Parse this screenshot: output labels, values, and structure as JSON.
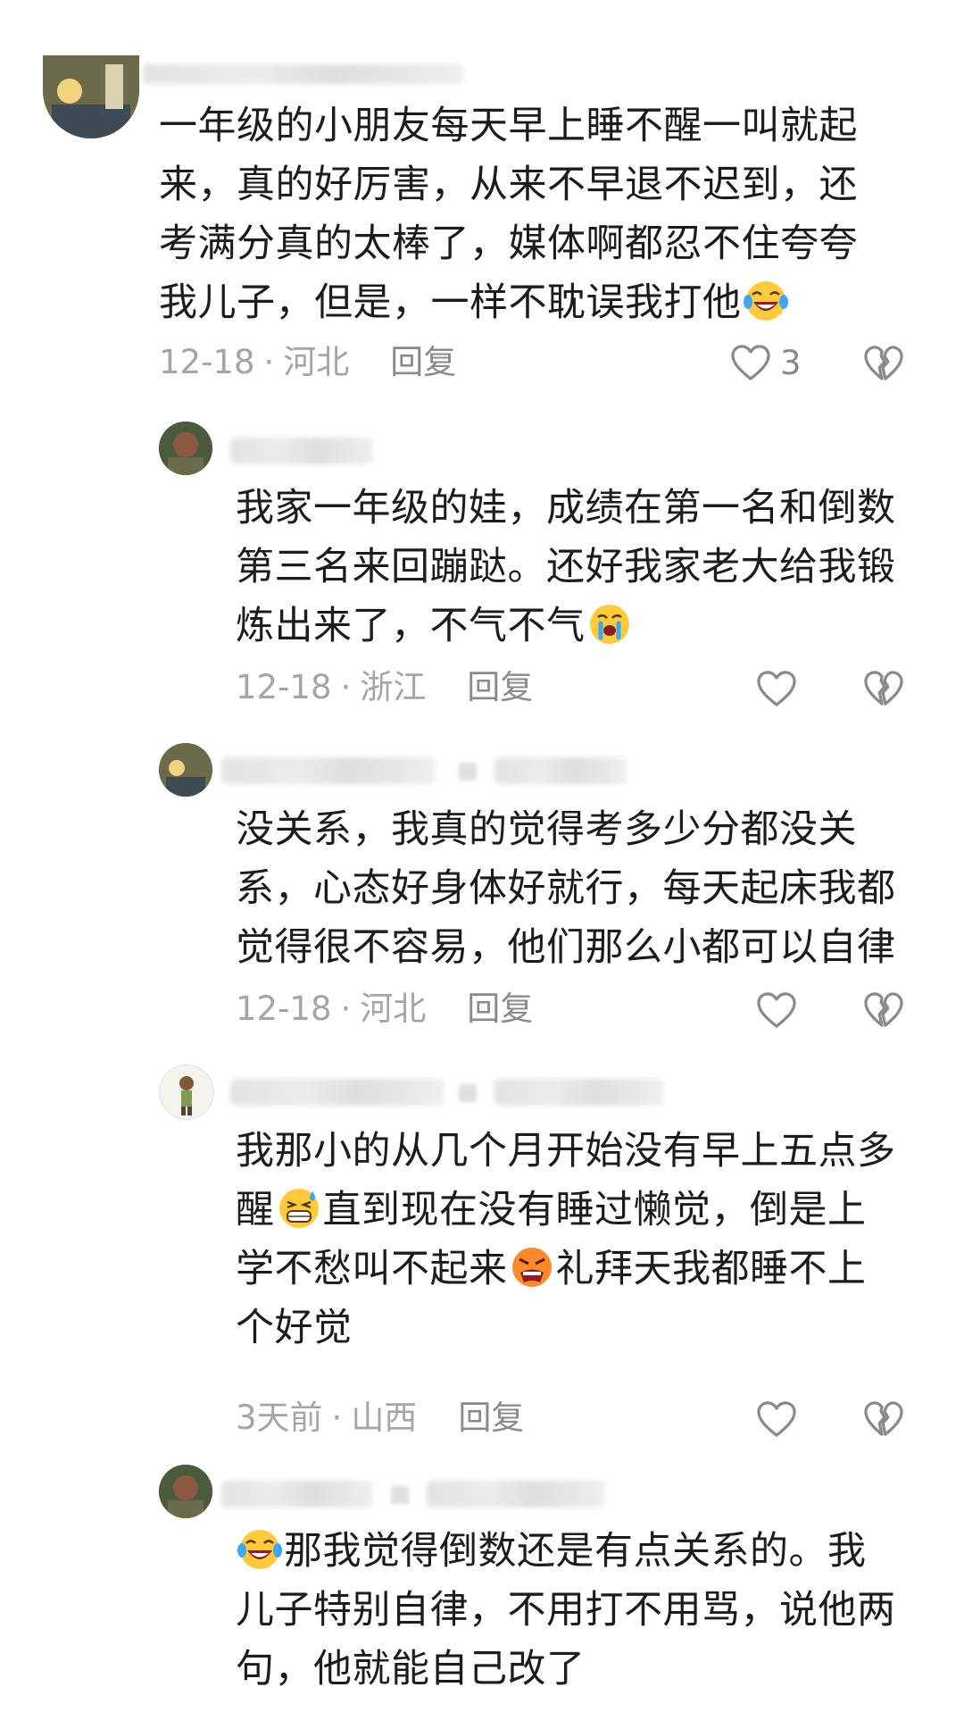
{
  "comments": [
    {
      "text_lines": [
        "一年级的小朋友每天早上睡不醒一叫就起",
        "来，真的好厉害，从来不早退不迟到，还",
        "考满分真的太棒了，媒体啊都忍不住夸夸",
        "我儿子，但是，一样不耽误我打他"
      ],
      "date": "12-18",
      "location": "河北",
      "reply_label": "回复",
      "like_count": "3"
    },
    {
      "text_lines": [
        "我家一年级的娃，成绩在第一名和倒数",
        "第三名来回蹦跶。还好我家老大给我锻",
        "炼出来了，不气不气"
      ],
      "date": "12-18",
      "location": "浙江",
      "reply_label": "回复",
      "like_count": ""
    },
    {
      "text_lines": [
        "没关系，我真的觉得考多少分都没关",
        "系，心态好身体好就行，每天起床我都",
        "觉得很不容易，他们那么小都可以自律"
      ],
      "date": "12-18",
      "location": "河北",
      "reply_label": "回复",
      "like_count": ""
    },
    {
      "text_lines": [
        "我那小的从几个月开始没有早上五点多",
        "直到现在没有睡过懒觉，倒是上",
        "学不愁叫不起来",
        "礼拜天我都睡不上",
        "个好觉"
      ],
      "segments": {
        "l2a": "醒",
        "l3b": "礼拜天我都睡不上"
      },
      "date": "3天前",
      "location": "山西",
      "reply_label": "回复",
      "like_count": ""
    },
    {
      "text_lines": [
        "那我觉得倒数还是有点关系的。我",
        "儿子特别自律，不用打不用骂，说他两",
        "句，他就能自己改了"
      ]
    }
  ],
  "icons": {
    "like": "heart-outline-icon",
    "dislike": "broken-heart-icon",
    "emoji_laugh_cry": "laugh-cry-emoji",
    "emoji_crying": "crying-emoji",
    "emoji_grimace": "grimace-sweat-emoji",
    "emoji_angry": "angry-emoji"
  },
  "colors": {
    "meta": "#a5a5a5",
    "text": "#1c1c1c",
    "icon": "#8a8a8a"
  }
}
